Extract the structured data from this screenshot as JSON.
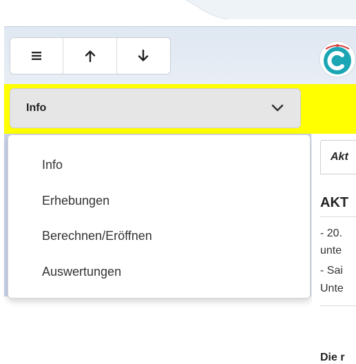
{
  "toolbar": {
    "menu_icon": "hamburger-icon",
    "up_icon": "arrow-up-icon",
    "down_icon": "arrow-down-icon"
  },
  "select": {
    "value": "Info",
    "chevron_icon": "chevron-down-icon"
  },
  "menu": {
    "items": [
      "Info",
      "Erhebungen",
      "Berechnen/Eröffnen",
      "Auswertungen"
    ]
  },
  "content": {
    "tab_label": "Akt",
    "heading": "AKT",
    "lines": [
      "- 20.",
      "unte",
      "- Sai",
      "Unte"
    ],
    "bold_line": "Die r"
  },
  "colors": {
    "header_bg": "#dfe7f2",
    "highlight_bar": "#ffff00",
    "select_bg": "#e6e6e6",
    "sidebar_bg": "#c9d4ec",
    "logo_teal": "#1aa6b4"
  }
}
